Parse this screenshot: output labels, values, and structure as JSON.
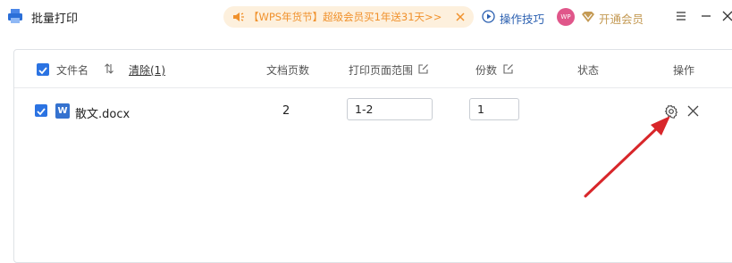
{
  "app": {
    "title": "批量打印"
  },
  "promo": {
    "text": "【WPS年货节】超级会员买1年送31天>>",
    "color": "#f0912c"
  },
  "toolbar": {
    "tips_label": "操作技巧",
    "avatar_text": "WP",
    "vip_label": "开通会员"
  },
  "table": {
    "clear_label": "清除(1)",
    "columns": {
      "filename": "文件名",
      "pages": "文档页数",
      "range": "打印页面范围",
      "copies": "份数",
      "status": "状态",
      "actions": "操作"
    },
    "rows": [
      {
        "checked": true,
        "file_icon": "W",
        "filename": "散文.docx",
        "pages": "2",
        "range": "1-2",
        "copies": "1",
        "status": ""
      }
    ]
  },
  "colors": {
    "accent": "#2b73e2",
    "link": "#2a5fb0",
    "vip": "#c49a54",
    "annotation_arrow": "#d8262a"
  }
}
